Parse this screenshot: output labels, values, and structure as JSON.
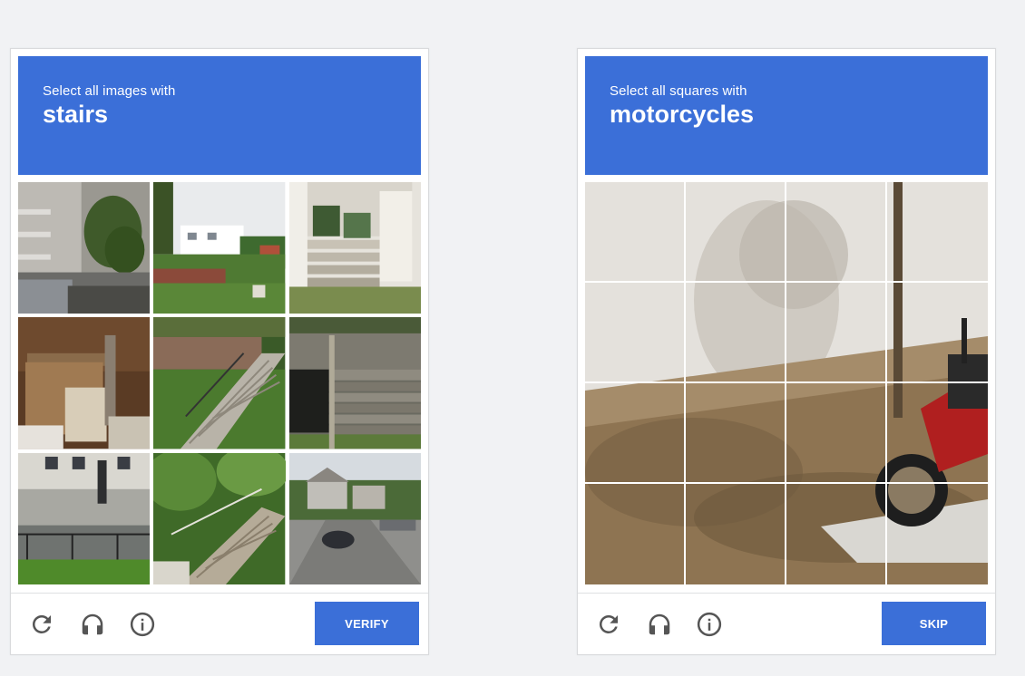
{
  "challenges": [
    {
      "prompt": "Select all images with",
      "keyword": "stairs",
      "action_label": "VERIFY",
      "grid": "3x3",
      "tiles": [
        "building-with-tree",
        "house-with-hedge",
        "porch-with-steps",
        "wooden-crates",
        "stairs-on-hillside",
        "concrete-stairs",
        "street-with-pedestrian",
        "overgrown-stairs",
        "suburban-road-with-car"
      ]
    },
    {
      "prompt": "Select all squares with",
      "keyword": "motorcycles",
      "action_label": "SKIP",
      "grid": "4x4",
      "scene": "motorcycle-by-wall"
    }
  ],
  "icons": {
    "reload": "reload-icon",
    "audio": "headphones-icon",
    "info": "info-icon"
  },
  "colors": {
    "accent": "#3b6fd8",
    "background": "#f1f2f4",
    "icon": "#555555"
  }
}
